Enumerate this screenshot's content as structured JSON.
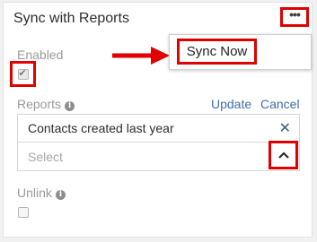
{
  "panel": {
    "title": "Sync with Reports",
    "more_icon": "more-dots-icon",
    "menu": {
      "sync_now_label": "Sync Now"
    }
  },
  "enabled": {
    "label": "Enabled",
    "checked": true
  },
  "reports": {
    "label": "Reports",
    "update_label": "Update",
    "cancel_label": "Cancel",
    "selected_item": "Contacts created last year",
    "select_placeholder": "Select"
  },
  "unlink": {
    "label": "Unlink",
    "checked": false
  },
  "colors": {
    "highlight": "#e00000",
    "link": "#3f6ea8",
    "label": "#9a9a9a"
  }
}
